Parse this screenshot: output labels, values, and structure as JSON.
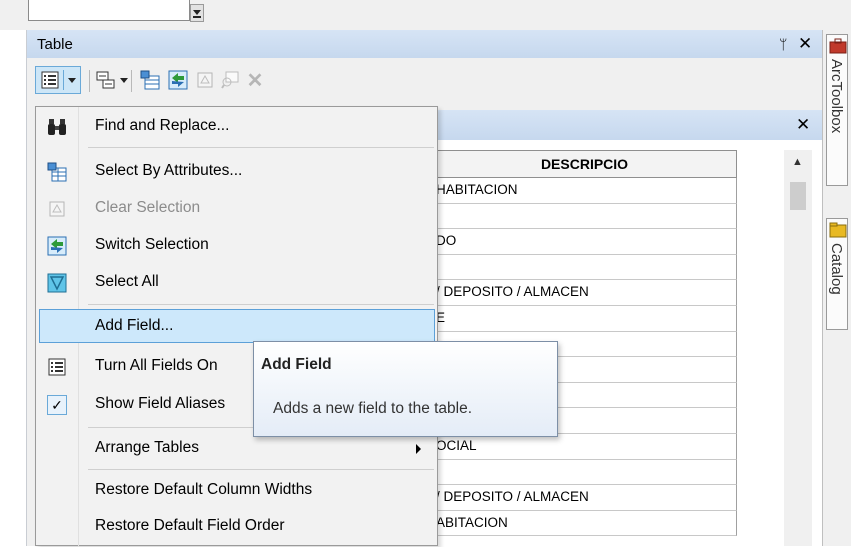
{
  "window": {
    "title": "Table",
    "pin_icon": "pin-icon",
    "close_icon": "close-icon"
  },
  "toolbar": {
    "buttons": [
      "table-options-icon",
      "related-tables-icon",
      "select-by-attributes-icon",
      "switch-selection-icon",
      "clear-selection-icon",
      "zoom-to-selected-icon",
      "delete-selected-icon"
    ]
  },
  "table": {
    "column_header": "DESCRIPCIO",
    "rows": [
      "HABITACION",
      "",
      "DO",
      "",
      "/ DEPOSITO / ALMACEN",
      "E",
      "",
      "",
      "",
      "",
      "OCIAL",
      "",
      "/ DEPOSITO / ALMACEN",
      "ABITACION"
    ]
  },
  "menu": {
    "items": [
      {
        "label": "Find and Replace...",
        "icon": "binoculars-icon"
      },
      {
        "label": "Select By Attributes...",
        "icon": "select-by-attributes-icon"
      },
      {
        "label": "Clear Selection",
        "icon": "clear-selection-icon",
        "disabled": true
      },
      {
        "label": "Switch Selection",
        "icon": "switch-selection-icon"
      },
      {
        "label": "Select All",
        "icon": "select-all-icon"
      },
      {
        "label": "Add Field...",
        "icon": "",
        "highlighted": true
      },
      {
        "label": "Turn All Fields On",
        "icon": "fields-list-icon"
      },
      {
        "label": "Show Field Aliases",
        "icon": "check-icon",
        "checked": true
      },
      {
        "label": "Arrange Tables",
        "submenu": true
      },
      {
        "label": "Restore Default Column Widths"
      },
      {
        "label": "Restore Default Field Order"
      }
    ]
  },
  "tooltip": {
    "title": "Add Field",
    "body": "Adds a new field to the table."
  },
  "dock": {
    "tabs": [
      {
        "label": "ArcToolbox",
        "icon": "toolbox-icon"
      },
      {
        "label": "Catalog",
        "icon": "catalog-icon"
      }
    ]
  }
}
